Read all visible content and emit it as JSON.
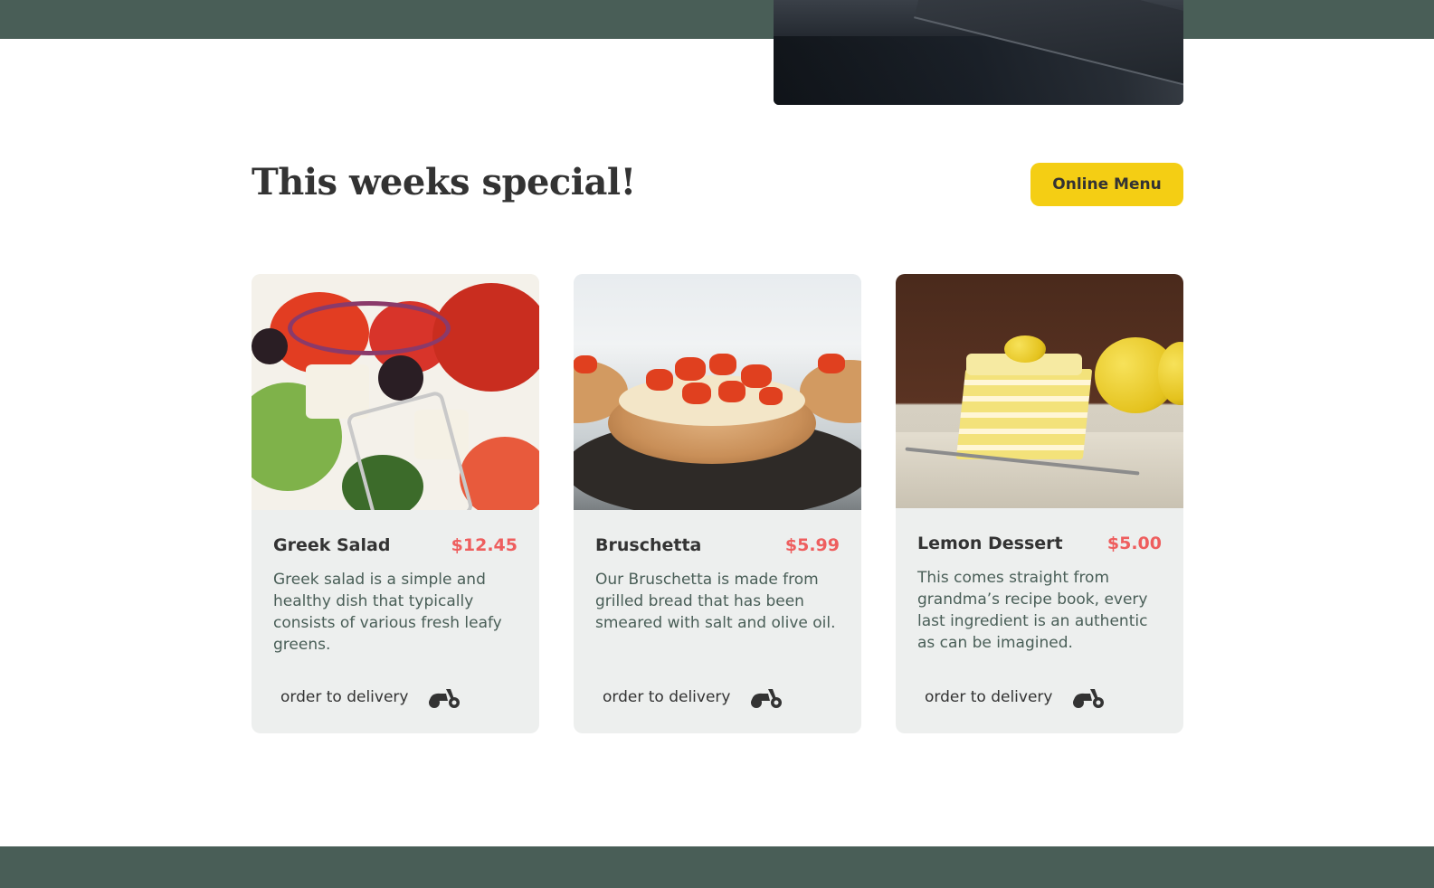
{
  "hero": {
    "image": "restaurant-hero-photo"
  },
  "specials": {
    "title": "This weeks special!",
    "online_menu_label": "Online Menu",
    "accent_color": "#f4ce14",
    "price_color": "#ee5e5e",
    "band_color": "#495e57",
    "dishes": [
      {
        "name": "Greek Salad",
        "price": "$12.45",
        "description": "Greek salad is a simple and healthy dish that typically consists of various fresh leafy greens.",
        "order_label": "order to delivery",
        "image": "greek-salad-photo",
        "icon": "scooter-icon"
      },
      {
        "name": "Bruschetta",
        "price": "$5.99",
        "description": "Our Bruschetta is made from grilled bread that has been smeared with salt and olive oil.",
        "order_label": "order to delivery",
        "image": "bruschetta-photo",
        "icon": "scooter-icon"
      },
      {
        "name": "Lemon Dessert",
        "price": "$5.00",
        "description": "This comes straight from grandma’s recipe book, every last ingredient is an authentic as can be imagined.",
        "order_label": "order to delivery",
        "image": "lemon-dessert-photo",
        "icon": "scooter-icon"
      }
    ]
  }
}
